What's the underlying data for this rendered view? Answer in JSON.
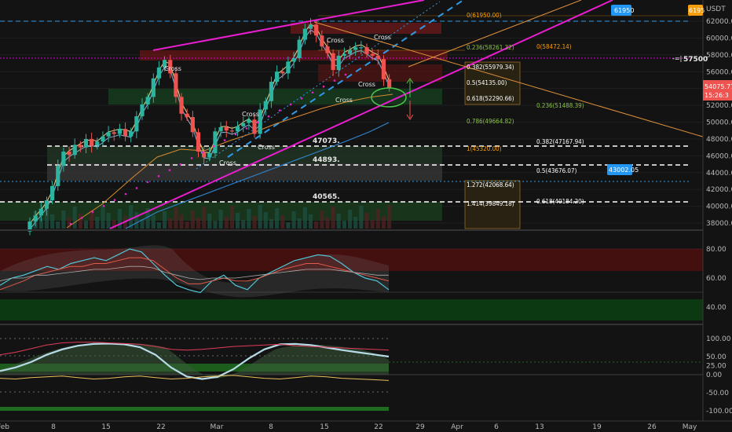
{
  "chart_data": [
    {
      "type": "candlestick",
      "name": "price",
      "y_ticks": [
        "62000.00",
        "60000.00",
        "58000.00",
        "56000.00",
        "54000.00",
        "52000.00",
        "50000.00",
        "48000.00",
        "46000.00",
        "44000.00",
        "42000.00",
        "40000.00",
        "38000.00"
      ],
      "x_ticks": [
        "Feb",
        "8",
        "15",
        "22",
        "Mar",
        "8",
        "15",
        "22",
        "29",
        "Apr",
        "6",
        "13",
        "19",
        "26",
        "May"
      ],
      "axis_header": "USDT",
      "top_value": "62000",
      "price_badges": [
        {
          "text": "61950",
          "color": "#2196f3"
        },
        {
          "text": "6195",
          "color": "#f59e0b"
        },
        {
          "text": "57500",
          "color": "#ffffff"
        },
        {
          "text": "54075.77",
          "color": "#ef5350"
        },
        {
          "text": "15:26:3",
          "color": "#ef5350"
        },
        {
          "text": "43002.05",
          "color": "#2196f3"
        }
      ],
      "fib_top_labels": [
        {
          "text": "0(61950.00)",
          "color": "#f59e0b"
        },
        {
          "text": "0(58472.14)",
          "color": "#f59e0b"
        },
        {
          "text": "0.236(58261.32)",
          "color": "#8bc34a"
        },
        {
          "text": "0.382(55979.34)",
          "color": "#ffffff"
        },
        {
          "text": "0.5(54135.00)",
          "color": "#ffffff"
        },
        {
          "text": "0.618(52290.66)",
          "color": "#ffffff"
        },
        {
          "text": "0.236(51488.39)",
          "color": "#8bc34a"
        },
        {
          "text": "0.786(49664.82)",
          "color": "#8bc34a"
        },
        {
          "text": "1(45320.00)",
          "color": "#f59e0b"
        },
        {
          "text": "0.382(47167.94)",
          "color": "#ffffff"
        },
        {
          "text": "0.5(43676.07)",
          "color": "#ffffff"
        },
        {
          "text": "1.272(42068.64)",
          "color": "#ffffff"
        },
        {
          "text": "1.414(39849.18)",
          "color": "#ffffff"
        },
        {
          "text": "0.618(40184.20)",
          "color": "#ffffff"
        }
      ],
      "level_labels": [
        "47073.",
        "44893.",
        "40565."
      ],
      "cross_labels": [
        "Cross",
        "Cross",
        "Cross",
        "Cross",
        "Cross",
        "Cross",
        "Cross",
        "Cross"
      ],
      "candles_close": [
        38200,
        38900,
        39700,
        40700,
        42400,
        44800,
        46500,
        46100,
        47300,
        47000,
        48000,
        47200,
        47700,
        48300,
        48800,
        48600,
        49200,
        48300,
        48900,
        50700,
        52100,
        53000,
        55200,
        56500,
        57400,
        55800,
        53000,
        51000,
        50600,
        48800,
        46500,
        45800,
        46300,
        48900,
        49400,
        49000,
        48900,
        49500,
        49900,
        50300,
        48600,
        51500,
        52500,
        54800,
        56000,
        55800,
        57200,
        57600,
        59800,
        61100,
        61600,
        60300,
        59000,
        58200,
        56200,
        57900,
        58100,
        58600,
        58900,
        58900,
        58100,
        57900,
        57500,
        55100,
        54075
      ]
    },
    {
      "type": "line",
      "name": "oscillator-1",
      "y_ticks": [
        "80.00",
        "60.00",
        "40.00"
      ],
      "ylim": [
        28,
        92
      ]
    },
    {
      "type": "line",
      "name": "oscillator-2",
      "y_ticks": [
        "100.00",
        "50.00",
        "25.00",
        "0.00",
        "-50.00",
        "-100.00"
      ],
      "ylim": [
        -108,
        108
      ]
    }
  ],
  "colors": {
    "background": "#131313",
    "up": "#2bb5a0",
    "down": "#ef5350",
    "channel": "#e91ecf",
    "blue_dash": "#2f9be8",
    "orange": "#e0913a"
  }
}
